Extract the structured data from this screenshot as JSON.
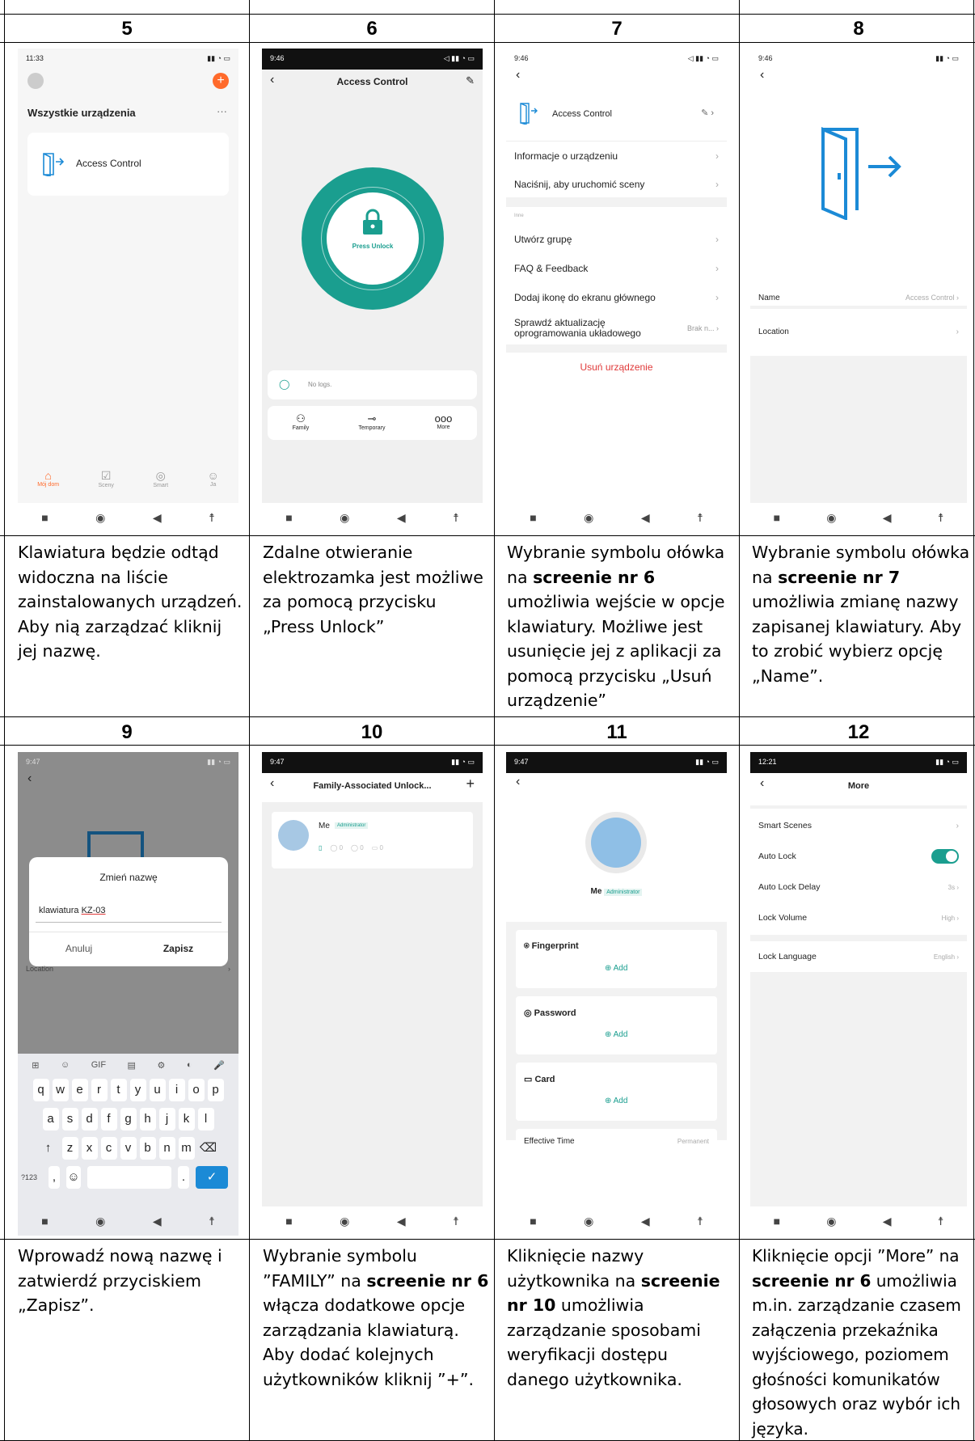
{
  "headers": [
    "5",
    "6",
    "7",
    "8",
    "9",
    "10",
    "11",
    "12"
  ],
  "descriptions": {
    "d5": [
      "Klawiatura będzie odtąd widoczna na liście zainstalowanych urządzeń. Aby nią zarządzać kliknij jej nazwę."
    ],
    "d6": [
      "Zdalne otwieranie elektrozamka jest możliwe za pomocą przycisku „Press Unlock”"
    ],
    "d7a": "Wybranie symbolu ołówka na ",
    "d7b": "screenie nr 6",
    "d7c": " umożliwia wejście w opcje klawiatury. Możliwe jest usunięcie jej z aplikacji za pomocą przycisku „Usuń urządzenie”",
    "d8a": "Wybranie symbolu ołówka na ",
    "d8b": "screenie nr 7",
    "d8c": " umożliwia zmianę nazwy zapisanej klawiatury. Aby to zrobić wybierz opcję „Name”.",
    "d9": "Wprowadź nową nazwę i zatwierdź przyciskiem „Zapisz”.",
    "d10a": "Wybranie symbolu ”FAMILY” na ",
    "d10b": "screenie nr 6",
    "d10c": " włącza dodatkowe opcje zarządzania klawiaturą. Aby dodać kolejnych użytkowników kliknij ”+”.",
    "d11a": "Kliknięcie nazwy użytkownika na ",
    "d11b": "screenie nr 10",
    "d11c": " umożliwia zarządzanie sposobami weryfikacji dostępu danego użytkownika.",
    "d12a": "Kliknięcie opcji ”More”  na ",
    "d12b": "screenie nr 6",
    "d12c": " umożliwia m.in. zarządzanie czasem załączenia przekaźnika wyjściowego, poziomem głośności komunikatów głosowych oraz wybór ich języka."
  },
  "s5": {
    "time": "11:33",
    "title": "Wszystkie urządzenia",
    "more": "···",
    "device": "Access Control",
    "tabs": [
      "Mój dom",
      "Sceny",
      "Smart",
      "Ja"
    ]
  },
  "s6": {
    "time": "9:46",
    "title": "Access Control",
    "btn": "Press Unlock",
    "logs": "No logs.",
    "actions": [
      "Family",
      "Temporary",
      "More"
    ]
  },
  "s7": {
    "time": "9:46",
    "device": "Access Control",
    "items1": [
      "Informacje o urządzeniu",
      "Naciśnij, aby uruchomić sceny"
    ],
    "section": "Inne",
    "items2": [
      "Utwórz grupę",
      "FAQ & Feedback",
      "Dodaj ikonę do ekranu głównego"
    ],
    "fw1": "Sprawdź aktualizację",
    "fw2": "oprogramowania układowego",
    "fw_val": "Brak n...",
    "remove": "Usuń urządzenie"
  },
  "s8": {
    "time": "9:46",
    "name_label": "Name",
    "name_val": "Access Control",
    "location": "Location"
  },
  "s9": {
    "time": "9:47",
    "dialog_title": "Zmień nazwę",
    "input_prefix": "klawiatura ",
    "input_model": "KZ-03",
    "cancel": "Anuluj",
    "save": "Zapisz",
    "location": "Location",
    "row1": "qwertyuiop",
    "row2": "asdfghjkl",
    "row3": "zxcvbnm",
    "gif": "GIF",
    "sym": "?123"
  },
  "s10": {
    "time": "9:47",
    "title": "Family-Associated Unlock...",
    "plus": "+",
    "user": "Me",
    "role": "Administrator",
    "counts": [
      "0",
      "0",
      "0"
    ]
  },
  "s11": {
    "time": "9:47",
    "user": "Me",
    "role": "Administrator",
    "sections": [
      "Fingerprint",
      "Password",
      "Card"
    ],
    "add": "Add",
    "eff": "Effective Time",
    "eff_val": "Permanent"
  },
  "s12": {
    "time": "12:21",
    "title": "More",
    "rows": [
      "Smart Scenes",
      "Auto Lock",
      "Auto Lock Delay",
      "Lock Volume",
      "Lock Language"
    ],
    "vals": [
      "",
      "",
      "3s",
      "High",
      "English"
    ]
  },
  "colors": {
    "accent": "#1a9e8f",
    "orange": "#ff6a2b",
    "red": "#e03a3a",
    "blue": "#1b8ad6"
  }
}
